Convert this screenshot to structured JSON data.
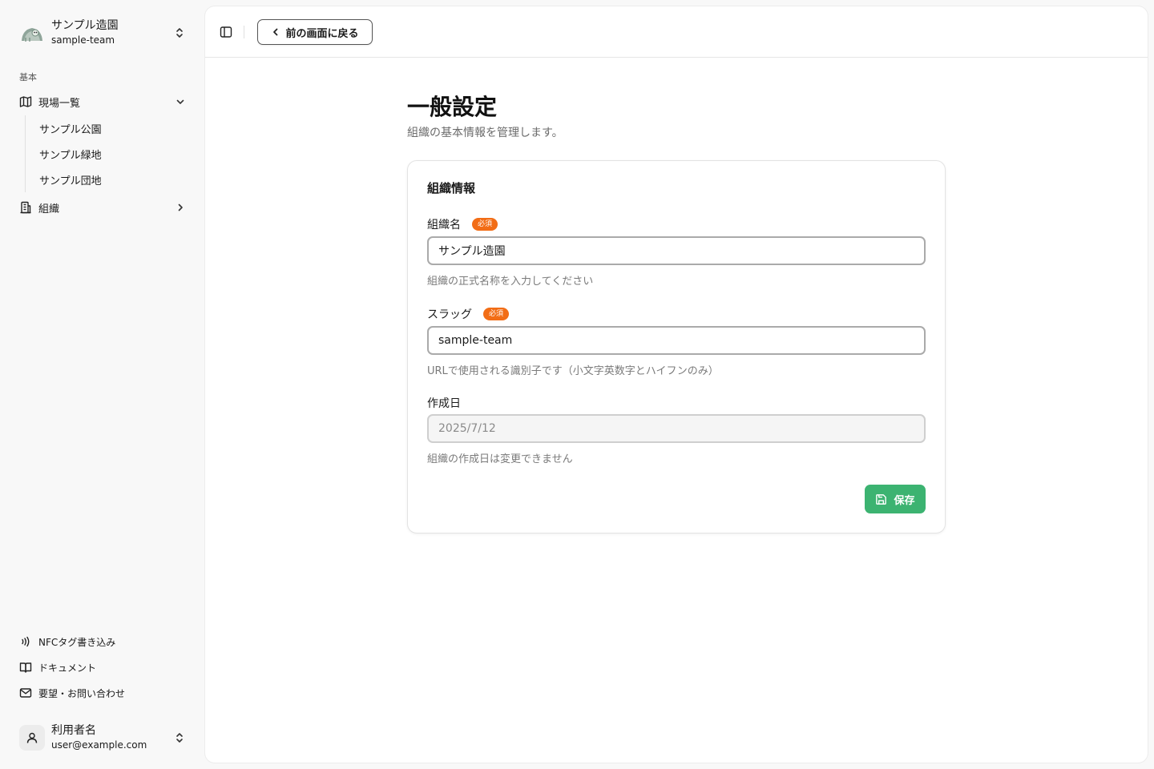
{
  "sidebar": {
    "team": {
      "name": "サンプル造園",
      "slug": "sample-team"
    },
    "group_label": "基本",
    "nav": {
      "sites": {
        "label": "現場一覧",
        "icon": "map-icon"
      },
      "sub_items": [
        "サンプル公園",
        "サンプル緑地",
        "サンプル団地"
      ],
      "org": {
        "label": "組織",
        "icon": "building-icon"
      }
    },
    "footer": {
      "nfc": {
        "label": "NFCタグ書き込み",
        "icon": "nfc-icon"
      },
      "docs": {
        "label": "ドキュメント",
        "icon": "book-icon"
      },
      "contact": {
        "label": "要望・お問い合わせ",
        "icon": "mail-icon"
      }
    },
    "user": {
      "name": "利用者名",
      "email": "user@example.com"
    }
  },
  "topbar": {
    "back_label": "前の画面に戻る"
  },
  "page": {
    "title": "一般設定",
    "description": "組織の基本情報を管理します。"
  },
  "card": {
    "title": "組織情報",
    "required_badge": "必須",
    "org_name": {
      "label": "組織名",
      "value": "サンプル造園",
      "help": "組織の正式名称を入力してください"
    },
    "slug": {
      "label": "スラッグ",
      "value": "sample-team",
      "help": "URLで使用される識別子です（小文字英数字とハイフンのみ）"
    },
    "created": {
      "label": "作成日",
      "value": "2025/7/12",
      "help": "組織の作成日は変更できません"
    },
    "save_label": "保存"
  },
  "colors": {
    "accent_green": "#3cb371",
    "required_orange": "#f26d16"
  }
}
